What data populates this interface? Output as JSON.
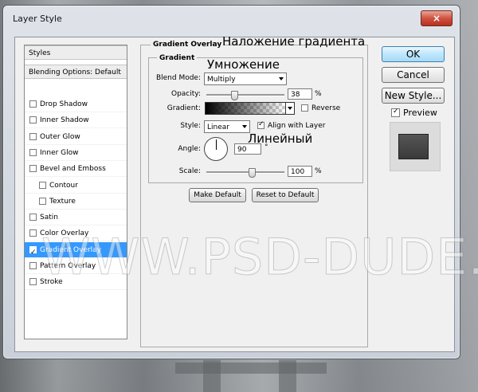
{
  "window": {
    "title": "Layer Style",
    "close_glyph": "×"
  },
  "sidebar": {
    "header": "Styles",
    "blending": "Blending Options: Default",
    "items": [
      {
        "label": "Drop Shadow",
        "checked": false
      },
      {
        "label": "Inner Shadow",
        "checked": false
      },
      {
        "label": "Outer Glow",
        "checked": false
      },
      {
        "label": "Inner Glow",
        "checked": false
      },
      {
        "label": "Bevel and Emboss",
        "checked": false
      },
      {
        "label": "Contour",
        "checked": false
      },
      {
        "label": "Texture",
        "checked": false
      },
      {
        "label": "Satin",
        "checked": false
      },
      {
        "label": "Color Overlay",
        "checked": false
      },
      {
        "label": "Gradient Overlay",
        "checked": true,
        "selected": true
      },
      {
        "label": "Pattern Overlay",
        "checked": false
      },
      {
        "label": "Stroke",
        "checked": false
      }
    ]
  },
  "panel": {
    "group_title": "Gradient Overlay",
    "sub_title": "Gradient",
    "blend_mode_label": "Blend Mode:",
    "blend_mode_value": "Multiply",
    "opacity_label": "Opacity:",
    "opacity_value": "38",
    "opacity_unit": "%",
    "gradient_label": "Gradient:",
    "reverse_label": "Reverse",
    "reverse_checked": false,
    "style_label": "Style:",
    "style_value": "Linear",
    "align_label": "Align with Layer",
    "align_checked": true,
    "angle_label": "Angle:",
    "angle_value": "90",
    "angle_unit": "°",
    "scale_label": "Scale:",
    "scale_value": "100",
    "scale_unit": "%",
    "make_default": "Make Default",
    "reset_default": "Reset to Default"
  },
  "actions": {
    "ok": "OK",
    "cancel": "Cancel",
    "new_style": "New Style...",
    "preview_label": "Preview",
    "preview_checked": true
  },
  "annotations": {
    "gradient_overlay_ru": "Наложение градиента",
    "multiply_ru": "Умножение",
    "linear_ru": "Линейный"
  },
  "watermark": "WWW.PSD-DUDE.COM",
  "colors": {
    "selection": "#3399ff",
    "close_button": "#c9402f",
    "ok_button": "#bee6fd"
  }
}
